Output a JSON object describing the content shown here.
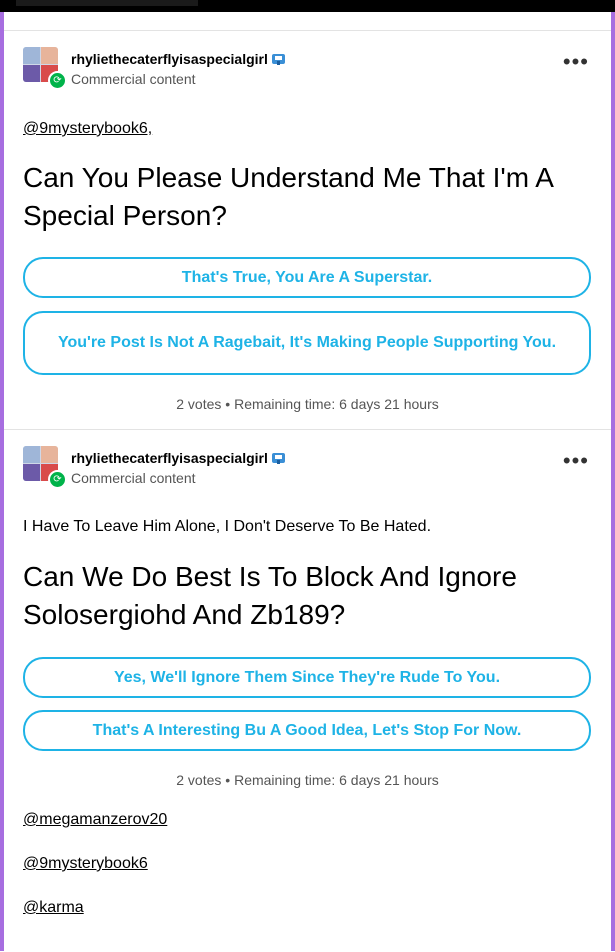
{
  "posts": [
    {
      "username": "rhyliethecaterflyisaspecialgirl",
      "subtitle": "Commercial content",
      "mention": "@9mysterybook6,",
      "question": "Can You Please Understand Me That I'm A Special Person?",
      "options": [
        "That's True, You Are A Superstar.",
        "You're Post Is Not A Ragebait, It's Making People Supporting You."
      ],
      "votes": "2 votes",
      "separator": "•",
      "remaining": "Remaining time: 6 days 21 hours"
    },
    {
      "username": "rhyliethecaterflyisaspecialgirl",
      "subtitle": "Commercial content",
      "body_text": "I Have To Leave Him Alone, I Don't Deserve To Be Hated.",
      "question": "Can We Do Best Is To Block And Ignore Solosergiohd And Zb189?",
      "options": [
        "Yes, We'll Ignore Them Since They're Rude To You.",
        "That's A Interesting Bu A Good Idea, Let's Stop For Now."
      ],
      "votes": "2 votes",
      "separator": "•",
      "remaining": "Remaining time: 6 days 21 hours",
      "mentions": [
        "@megamanzerov20",
        "@9mysterybook6",
        "@karma"
      ]
    }
  ],
  "icons": {
    "more": "more-options-icon",
    "verified": "verified-badge-icon",
    "reblog": "reblog-badge-icon"
  },
  "colors": {
    "accent": "#1eb3e6",
    "side_rail": "#a76ee0",
    "badge": "#00b34a"
  }
}
